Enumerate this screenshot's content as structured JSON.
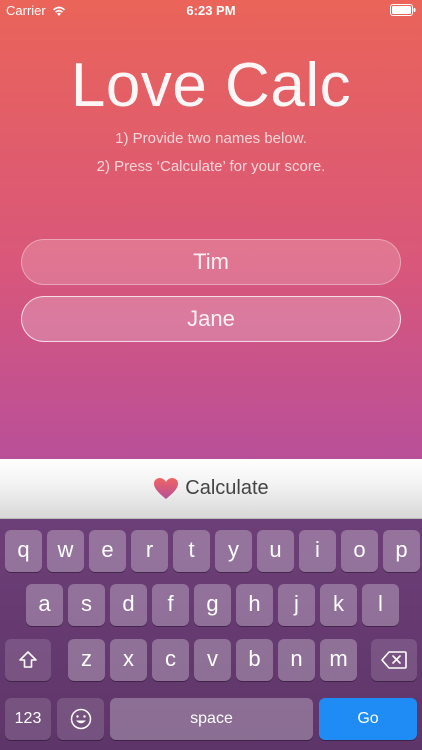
{
  "status": {
    "carrier": "Carrier",
    "time": "6:23 PM"
  },
  "app": {
    "title": "Love Calc",
    "instruction_1": "1) Provide two names below.",
    "instruction_2": "2) Press ‘Calculate’ for your score."
  },
  "form": {
    "name1": "Tim",
    "name2": "Jane"
  },
  "calculate": {
    "label": "Calculate"
  },
  "keyboard": {
    "row1": [
      "q",
      "w",
      "e",
      "r",
      "t",
      "y",
      "u",
      "i",
      "o",
      "p"
    ],
    "row2": [
      "a",
      "s",
      "d",
      "f",
      "g",
      "h",
      "j",
      "k",
      "l"
    ],
    "row3": [
      "z",
      "x",
      "c",
      "v",
      "b",
      "n",
      "m"
    ],
    "numbers_label": "123",
    "space_label": "space",
    "go_label": "Go"
  },
  "colors": {
    "accent": "#1e8cf4",
    "heart": "#e0556d"
  }
}
